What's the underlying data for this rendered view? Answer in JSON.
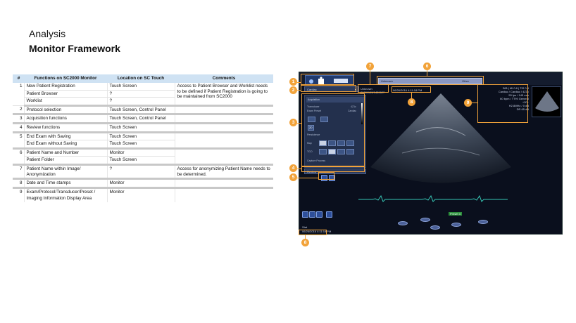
{
  "page": {
    "title_line1": "Analysis",
    "title_line2": "Monitor Framework"
  },
  "table": {
    "headers": [
      "#",
      "Functions on SC2000 Monitor",
      "Location on SC Touch",
      "Comments"
    ],
    "groups": [
      {
        "num": "1",
        "rows": [
          {
            "func": "New Patient Registration",
            "loc": "Touch Screen"
          },
          {
            "func": "Patient Browser",
            "loc": "?"
          },
          {
            "func": "Worklist",
            "loc": "?"
          }
        ],
        "comment": "Access to Patient Browser and Worklist needs to be defined if Patient Registration is going to be maintained from SC2000"
      },
      {
        "num": "2",
        "rows": [
          {
            "func": "Protocol selection",
            "loc": "Touch Screen, Control Panel"
          }
        ],
        "comment": ""
      },
      {
        "num": "3",
        "rows": [
          {
            "func": "Acquisition functions",
            "loc": "Touch Screen, Control Panel"
          }
        ],
        "comment": ""
      },
      {
        "num": "4",
        "rows": [
          {
            "func": "Review functions",
            "loc": "Touch Screen"
          }
        ],
        "comment": ""
      },
      {
        "num": "5",
        "rows": [
          {
            "func": "End Exam with Saving",
            "loc": "Touch Screen"
          },
          {
            "func": "End Exam without Saving",
            "loc": "Touch Screen"
          }
        ],
        "comment": ""
      },
      {
        "num": "6",
        "rows": [
          {
            "func": "Patient Name and Number",
            "loc": "Monitor"
          },
          {
            "func": "Patient Folder",
            "loc": "Touch Screen"
          }
        ],
        "comment": ""
      },
      {
        "num": "7",
        "rows": [
          {
            "func": "Patient Name within Image/ Anonymization",
            "loc": "?"
          }
        ],
        "comment": "Access for anonymizing Patient Name needs to be determined."
      },
      {
        "num": "8",
        "rows": [
          {
            "func": "Date and Time stamps",
            "loc": "Monitor"
          }
        ],
        "comment": ""
      },
      {
        "num": "9",
        "rows": [
          {
            "func": "Exam/Protocol/Transducer/Preset /",
            "loc": "Monitor"
          },
          {
            "func": "Imaging Information Display Area",
            "loc": ""
          }
        ],
        "comment": ""
      }
    ]
  },
  "screenshot": {
    "study_label": "Cardiac",
    "patient_name": "Unknown",
    "patient_id": "20081103/0450627",
    "patient_bar_label": "Unknown",
    "patient_bar_right": "Other",
    "datetime_top": "06/26/2016 4:11:18 PM",
    "datetime_bottom": "06/26/2016 4:11:18 PM",
    "bottom_label": "Stat",
    "preset_label": "Preset 3",
    "info_lines": [
      "B/B | MI 0.8 | TIS 0.4",
      "Cardiac / Cardiac / 4Z1c",
      "",
      "53 fps / 145 mm",
      "60 bpm / TTHI General",
      "+20+",
      "H2.8MHz / 0 dB",
      "DR 65 dB"
    ],
    "left_panel": {
      "header": "Acquisition",
      "row1": "Transducer",
      "row1_val": "4Z1c",
      "row2": "Exam Preset",
      "row2_val": "Cardiac",
      "mode": "2D",
      "row3": "Persistence",
      "row4": "Map",
      "row5": "TGO",
      "row6": "Capture Process",
      "review_label": "Review"
    },
    "colors": {
      "accent": "#f2a33a",
      "screen_bg": "#0a0f1d",
      "ecg": "#37c7b5"
    }
  },
  "callouts": [
    "1",
    "2",
    "3",
    "4",
    "5",
    "6",
    "7",
    "8",
    "9",
    "8"
  ]
}
